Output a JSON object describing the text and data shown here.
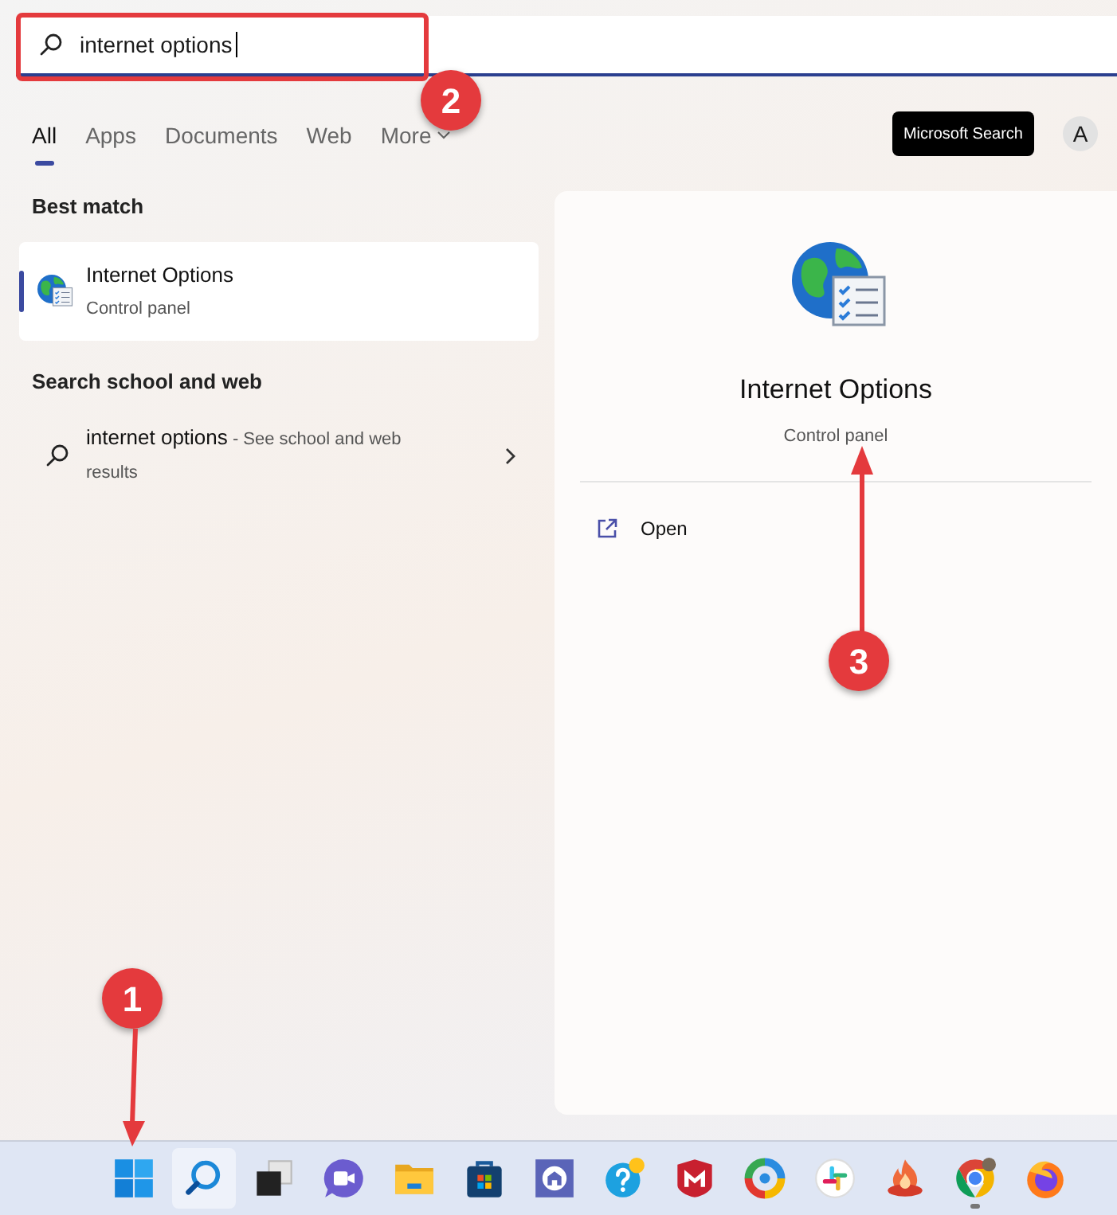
{
  "search": {
    "value": "internet options"
  },
  "tabs": [
    {
      "label": "All",
      "selected": true
    },
    {
      "label": "Apps",
      "selected": false
    },
    {
      "label": "Documents",
      "selected": false
    },
    {
      "label": "Web",
      "selected": false
    },
    {
      "label": "More",
      "selected": false,
      "dropdown": true
    }
  ],
  "microsoft_search_button": "Microsoft Search",
  "account_initial": "A",
  "best_match": {
    "heading": "Best match",
    "item": {
      "title": "Internet Options",
      "subtitle": "Control panel",
      "selected": true
    }
  },
  "web_section": {
    "heading": "Search school and web",
    "item": {
      "query": "internet options",
      "suffix": " - See school and web results"
    }
  },
  "details": {
    "title": "Internet Options",
    "subtitle": "Control panel",
    "actions": [
      {
        "label": "Open"
      }
    ]
  },
  "taskbar": [
    {
      "kind": "start",
      "selected": false,
      "running": false
    },
    {
      "kind": "search",
      "selected": true,
      "running": false
    },
    {
      "kind": "taskview",
      "selected": false,
      "running": false
    },
    {
      "kind": "chat",
      "selected": false,
      "running": false
    },
    {
      "kind": "explorer",
      "selected": false,
      "running": false
    },
    {
      "kind": "store",
      "selected": false,
      "running": false
    },
    {
      "kind": "app",
      "selected": false,
      "running": false
    },
    {
      "kind": "help",
      "selected": false,
      "running": false
    },
    {
      "kind": "shield",
      "selected": false,
      "running": false
    },
    {
      "kind": "ring",
      "selected": false,
      "running": false
    },
    {
      "kind": "slack",
      "selected": false,
      "running": false
    },
    {
      "kind": "flame",
      "selected": false,
      "running": false
    },
    {
      "kind": "chrome",
      "selected": false,
      "running": true
    },
    {
      "kind": "firefox",
      "selected": false,
      "running": false
    }
  ],
  "annotations": [
    {
      "label": "1"
    },
    {
      "label": "2"
    },
    {
      "label": "3"
    }
  ]
}
